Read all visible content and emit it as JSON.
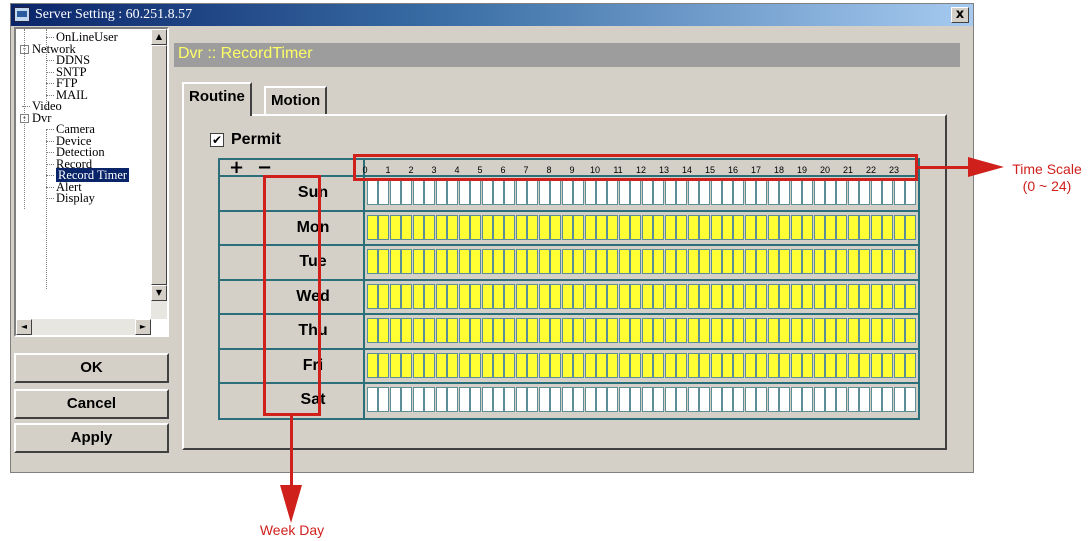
{
  "window": {
    "title": "Server Setting : 60.251.8.57",
    "close_label": "x"
  },
  "tree": {
    "items": [
      {
        "label": "OnLineUser",
        "level": 2
      },
      {
        "label": "Network",
        "level": 1,
        "expander": "-"
      },
      {
        "label": "DDNS",
        "level": 2
      },
      {
        "label": "SNTP",
        "level": 2
      },
      {
        "label": "FTP",
        "level": 2
      },
      {
        "label": "MAIL",
        "level": 2
      },
      {
        "label": "Video",
        "level": 1
      },
      {
        "label": "Dvr",
        "level": 1,
        "expander": "-"
      },
      {
        "label": "Camera",
        "level": 2
      },
      {
        "label": "Device",
        "level": 2
      },
      {
        "label": "Detection",
        "level": 2
      },
      {
        "label": "Record",
        "level": 2
      },
      {
        "label": "Record Timer",
        "level": 2,
        "selected": true
      },
      {
        "label": "Alert",
        "level": 2
      },
      {
        "label": "Display",
        "level": 2
      }
    ],
    "scroll_up": "▲",
    "scroll_down": "▼",
    "scroll_left": "◄",
    "scroll_right": "►"
  },
  "buttons": {
    "ok": "OK",
    "cancel": "Cancel",
    "apply": "Apply"
  },
  "header": {
    "title": "Dvr :: RecordTimer"
  },
  "tabs": [
    {
      "label": "Routine",
      "active": true
    },
    {
      "label": "Motion",
      "active": false
    }
  ],
  "permit": {
    "label": "Permit",
    "checked": true,
    "check_glyph": "✔"
  },
  "grid": {
    "zoom_in": "+",
    "zoom_out": "−",
    "hours": [
      "0",
      "1",
      "2",
      "3",
      "4",
      "5",
      "6",
      "7",
      "8",
      "9",
      "10",
      "11",
      "12",
      "13",
      "14",
      "15",
      "16",
      "17",
      "18",
      "19",
      "20",
      "21",
      "22",
      "23"
    ],
    "days": [
      {
        "label": "Sun",
        "recording": false
      },
      {
        "label": "Mon",
        "recording": true
      },
      {
        "label": "Tue",
        "recording": true
      },
      {
        "label": "Wed",
        "recording": true
      },
      {
        "label": "Thu",
        "recording": true
      },
      {
        "label": "Fri",
        "recording": true
      },
      {
        "label": "Sat",
        "recording": false
      }
    ],
    "colors": {
      "on": "#ffff33",
      "off": "#ffffff",
      "line": "#2a6f7a"
    }
  },
  "annotations": {
    "time_scale": "Time Scale\n(0 ~ 24)",
    "week_day": "Week Day",
    "color": "#d0201c"
  }
}
